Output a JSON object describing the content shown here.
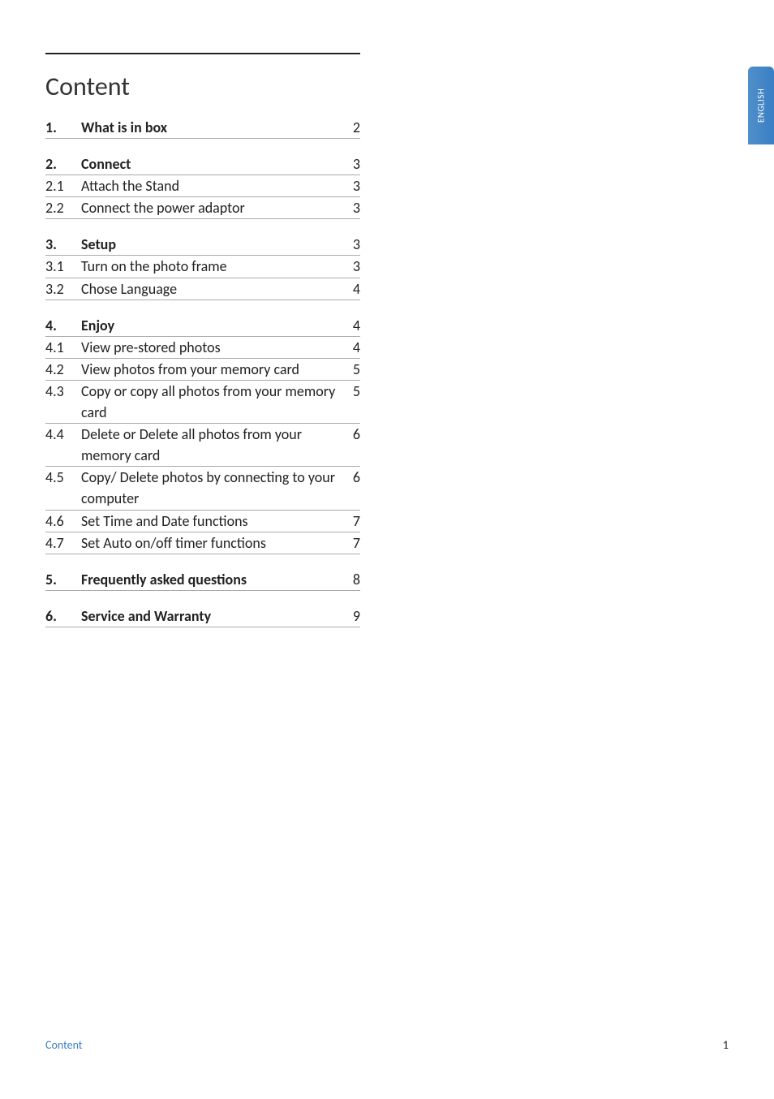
{
  "heading": "Content",
  "toc": [
    {
      "entries": [
        {
          "num": "1.",
          "title": "What is in box",
          "page": "2",
          "bold": true
        }
      ]
    },
    {
      "entries": [
        {
          "num": "2.",
          "title": "Connect",
          "page": "3",
          "bold": true
        },
        {
          "num": "2.1",
          "title": "Attach the Stand",
          "page": "3",
          "bold": false
        },
        {
          "num": "2.2",
          "title": "Connect the power adaptor",
          "page": "3",
          "bold": false
        }
      ]
    },
    {
      "entries": [
        {
          "num": "3.",
          "title": "Setup",
          "page": "3",
          "bold": true
        },
        {
          "num": "3.1",
          "title": "Turn on the photo frame",
          "page": "3",
          "bold": false
        },
        {
          "num": "3.2",
          "title": "Chose Language",
          "page": "4",
          "bold": false
        }
      ]
    },
    {
      "entries": [
        {
          "num": "4.",
          "title": "Enjoy",
          "page": "4",
          "bold": true
        },
        {
          "num": "4.1",
          "title": "View pre-stored photos",
          "page": "4",
          "bold": false
        },
        {
          "num": "4.2",
          "title": "View photos from your memory card",
          "page": "5",
          "bold": false
        },
        {
          "num": "4.3",
          "title": "Copy or copy all photos from your memory card",
          "page": "5",
          "bold": false
        },
        {
          "num": "4.4",
          "title": "Delete or Delete all photos from your memory card",
          "page": "6",
          "bold": false
        },
        {
          "num": "4.5",
          "title": "Copy/ Delete photos by connecting to your computer",
          "page": "6",
          "bold": false
        },
        {
          "num": "4.6",
          "title": "Set Time and Date functions",
          "page": "7",
          "bold": false
        },
        {
          "num": "4.7",
          "title": "Set Auto on/off timer functions",
          "page": "7",
          "bold": false
        }
      ]
    },
    {
      "entries": [
        {
          "num": "5.",
          "title": "Frequently asked questions",
          "page": "8",
          "bold": true
        }
      ]
    },
    {
      "entries": [
        {
          "num": "6.",
          "title": "Service and Warranty",
          "page": "9",
          "bold": true
        }
      ]
    }
  ],
  "sideTab": "ENGLISH",
  "footer": {
    "left": "Content",
    "right": "1"
  }
}
